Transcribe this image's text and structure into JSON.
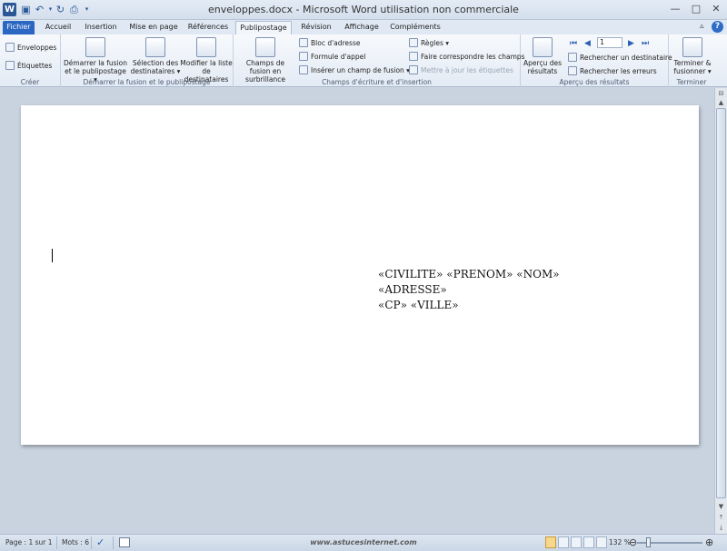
{
  "titlebar": {
    "title": "enveloppes.docx  -  Microsoft Word utilisation non commerciale",
    "qat": {
      "save_icon": "save-icon",
      "undo_icon": "undo-icon",
      "redo_icon": "redo-icon",
      "print_preview_icon": "print-preview-icon"
    },
    "window": {
      "minimize": "—",
      "maximize": "□",
      "close": "✕"
    }
  },
  "tabs": [
    "Fichier",
    "Accueil",
    "Insertion",
    "Mise en page",
    "Références",
    "Publipostage",
    "Révision",
    "Affichage",
    "Compléments"
  ],
  "active_tab": "Publipostage",
  "ribbon": {
    "creer": {
      "label": "Créer",
      "enveloppes": "Enveloppes",
      "etiquettes": "Étiquettes"
    },
    "demarrer": {
      "label": "Démarrer la fusion et le publipostage",
      "demarrer_fusion": "Démarrer la fusion et le publipostage ▾",
      "selection_destinataires": "Sélection des destinataires ▾",
      "modifier_liste": "Modifier la liste de destinataires"
    },
    "champs": {
      "label": "Champs d'écriture et d'insertion",
      "champs_surbrillance": "Champs de fusion en surbrillance",
      "bloc_adresse": "Bloc d'adresse",
      "formule_appel": "Formule d'appel",
      "inserer_champ": "Insérer un champ de fusion ▾",
      "regles": "Règles ▾",
      "faire_correspondre": "Faire correspondre les champs",
      "mettre_a_jour": "Mettre à jour les étiquettes"
    },
    "apercu": {
      "label": "Aperçu des résultats",
      "apercu_resultats": "Aperçu des résultats",
      "record_value": "1",
      "rechercher_destinataire": "Rechercher un destinataire",
      "rechercher_erreurs": "Rechercher les erreurs"
    },
    "terminer": {
      "label": "Terminer",
      "terminer_fusionner": "Terminer & fusionner ▾"
    }
  },
  "document": {
    "address_lines": [
      "«CIVILITE» «PRENOM» «NOM»",
      "«ADRESSE»",
      "«CP» «VILLE»"
    ]
  },
  "statusbar": {
    "page": "Page : 1 sur 1",
    "words": "Mots : 6",
    "watermark": "www.astucesinternet.com",
    "zoom": "132 %",
    "zoom_level_percent": 132
  }
}
